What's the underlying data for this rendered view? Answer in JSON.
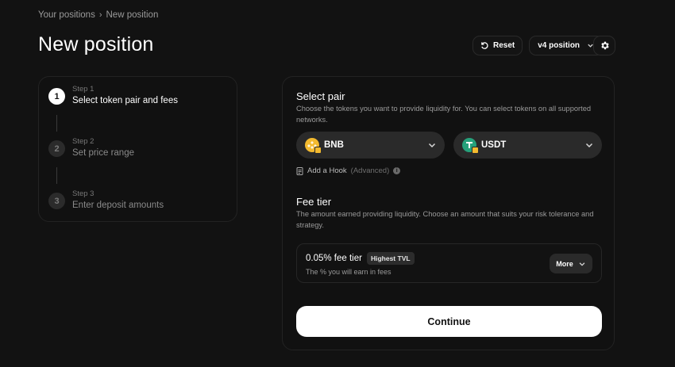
{
  "breadcrumb": {
    "parent": "Your positions",
    "separator": "›",
    "current": "New position"
  },
  "page": {
    "title": "New position"
  },
  "toolbar": {
    "reset_label": "Reset",
    "version_label": "v4 position"
  },
  "steps": [
    {
      "small": "Step 1",
      "label": "Select token pair and fees",
      "number": "1",
      "active": true
    },
    {
      "small": "Step 2",
      "label": "Set price range",
      "number": "2",
      "active": false
    },
    {
      "small": "Step 3",
      "label": "Enter deposit amounts",
      "number": "3",
      "active": false
    }
  ],
  "select_pair": {
    "title": "Select pair",
    "description": "Choose the tokens you want to provide liquidity for. You can select tokens on all supported networks.",
    "token_a": {
      "symbol": "BNB",
      "icon": "bnb-token-icon",
      "color": "#f3ba2f"
    },
    "token_b": {
      "symbol": "USDT",
      "icon": "usdt-token-icon",
      "color": "#26a17b"
    },
    "hook_label": "Add a Hook",
    "hook_advanced": "(Advanced)"
  },
  "fee_tier": {
    "title": "Fee tier",
    "description": "The amount earned providing liquidity. Choose an amount that suits your risk tolerance and strategy.",
    "selected": "0.05% fee tier",
    "badge": "Highest TVL",
    "subtitle": "The % you will earn in fees",
    "more_label": "More"
  },
  "continue_label": "Continue"
}
